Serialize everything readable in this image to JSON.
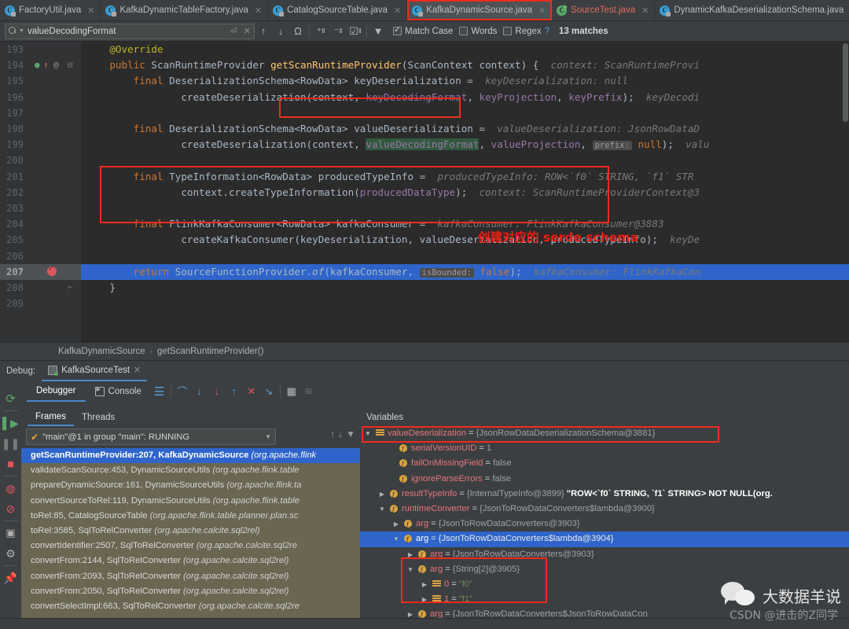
{
  "window": {
    "title": "IntelliJ IDEA - KafkaDynamicSource.java - Debugger"
  },
  "tabs": [
    {
      "label": "FactoryUtil.java",
      "icon": "java-class-icon",
      "active": false,
      "highlighted": false,
      "style": "normal"
    },
    {
      "label": "KafkaDynamicTableFactory.java",
      "icon": "java-class-icon",
      "active": false,
      "highlighted": false,
      "style": "normal"
    },
    {
      "label": "CatalogSourceTable.java",
      "icon": "java-class-icon",
      "active": false,
      "highlighted": false,
      "style": "normal"
    },
    {
      "label": "KafkaDynamicSource.java",
      "icon": "java-class-icon",
      "active": true,
      "highlighted": true,
      "style": "normal"
    },
    {
      "label": "SourceTest.java",
      "icon": "java-runnable-class-icon",
      "active": false,
      "highlighted": false,
      "style": "red"
    },
    {
      "label": "DynamicKafkaDeserializationSchema.java",
      "icon": "java-class-icon",
      "active": false,
      "highlighted": false,
      "style": "normal"
    }
  ],
  "find": {
    "query": "valueDecodingFormat",
    "placeholder": "Search",
    "match_case_label": "Match Case",
    "match_case_checked": true,
    "words_label": "Words",
    "words_checked": false,
    "regex_label": "Regex",
    "regex_checked": false,
    "help_label": "?",
    "matches_label": "13 matches",
    "buttons": [
      "prev-match",
      "next-match",
      "select-all-occurrences",
      "add-line-before",
      "add-line-after",
      "toggle-selection",
      "filter"
    ]
  },
  "editor": {
    "lines": [
      {
        "num": "193",
        "current": false,
        "text": "@Override"
      },
      {
        "num": "194",
        "current": false,
        "text": "public ScanRuntimeProvider getScanRuntimeProvider(ScanContext context) {   context: ScanRuntimeProvi"
      },
      {
        "num": "195",
        "current": false,
        "text": "final DeserializationSchema<RowData> keyDeserialization =   keyDeserialization: null"
      },
      {
        "num": "196",
        "current": false,
        "text": "createDeserialization(context, keyDecodingFormat, keyProjection, keyPrefix);   keyDecodi"
      },
      {
        "num": "197",
        "current": false,
        "text": ""
      },
      {
        "num": "198",
        "current": false,
        "text": "final DeserializationSchema<RowData> valueDeserialization =   valueDeserialization: JsonRowDataD"
      },
      {
        "num": "199",
        "current": false,
        "text": "createDeserialization(context, valueDecodingFormat, valueProjection, prefix: null);   valu"
      },
      {
        "num": "200",
        "current": false,
        "text": ""
      },
      {
        "num": "201",
        "current": false,
        "text": "final TypeInformation<RowData> producedTypeInfo =   producedTypeInfo: ROW<`f0` STRING, `f1` STR"
      },
      {
        "num": "202",
        "current": false,
        "text": "context.createTypeInformation(producedDataType);   context: ScanRuntimeProviderContext@3"
      },
      {
        "num": "203",
        "current": false,
        "text": ""
      },
      {
        "num": "204",
        "current": false,
        "text": "final FlinkKafkaConsumer<RowData> kafkaConsumer =   kafkaConsumer: FlinkKafkaConsumer@3883"
      },
      {
        "num": "205",
        "current": false,
        "text": "createKafkaConsumer(keyDeserialization, valueDeserialization, producedTypeInfo);   keyDe"
      },
      {
        "num": "206",
        "current": false,
        "text": ""
      },
      {
        "num": "207",
        "current": true,
        "text": "return SourceFunctionProvider.of(kafkaConsumer, isBounded: false);   kafkaConsumer: FlinkKafkaCon"
      },
      {
        "num": "208",
        "current": false,
        "text": "}"
      },
      {
        "num": "209",
        "current": false,
        "text": ""
      }
    ],
    "annotation_cn": "创建对应的 serde schema",
    "highlighted_token": "valueDecodingFormat",
    "method_name_boxed": "getScanRuntimeProvider",
    "breakpoint_line": "207"
  },
  "breadcrumb": {
    "class": "KafkaDynamicSource",
    "separator": "›",
    "method": "getScanRuntimeProvider()"
  },
  "debug": {
    "label": "Debug:",
    "session": "KafkaSourceTest",
    "tabs": [
      {
        "label": "Debugger",
        "selected": true
      },
      {
        "label": "Console",
        "selected": false
      }
    ],
    "toolbar_icons": [
      "show-execution-point",
      "step-over",
      "step-into",
      "force-step-into",
      "step-out",
      "drop-frame",
      "run-to-cursor",
      "evaluate-expression",
      "settings"
    ],
    "rail_icons": [
      "rerun-icon",
      "resume-icon",
      "pause-icon",
      "stop-icon",
      "view-breakpoints-icon",
      "mute-breakpoints-icon",
      "screenshot-icon",
      "settings-gear-icon",
      "pin-icon"
    ]
  },
  "frames": {
    "tabs": [
      {
        "label": "Frames",
        "selected": true
      },
      {
        "label": "Threads",
        "selected": false
      }
    ],
    "thread_selector": "\"main\"@1 in group \"main\": RUNNING",
    "rows": [
      {
        "main": "getScanRuntimeProvider:207, KafkaDynamicSource",
        "pkg": "(org.apache.flink",
        "selected": true
      },
      {
        "main": "validateScanSource:453, DynamicSourceUtils",
        "pkg": "(org.apache.flink.table",
        "selected": false
      },
      {
        "main": "prepareDynamicSource:161, DynamicSourceUtils",
        "pkg": "(org.apache.flink.ta",
        "selected": false
      },
      {
        "main": "convertSourceToRel:119, DynamicSourceUtils",
        "pkg": "(org.apache.flink.table",
        "selected": false
      },
      {
        "main": "toRel:85, CatalogSourceTable",
        "pkg": "(org.apache.flink.table.planner.plan.sc",
        "selected": false
      },
      {
        "main": "toRel:3585, SqlToRelConverter",
        "pkg": "(org.apache.calcite.sql2rel)",
        "selected": false
      },
      {
        "main": "convertIdentifier:2507, SqlToRelConverter",
        "pkg": "(org.apache.calcite.sql2re",
        "selected": false
      },
      {
        "main": "convertFrom:2144, SqlToRelConverter",
        "pkg": "(org.apache.calcite.sql2rel)",
        "selected": false
      },
      {
        "main": "convertFrom:2093, SqlToRelConverter",
        "pkg": "(org.apache.calcite.sql2rel)",
        "selected": false
      },
      {
        "main": "convertFrom:2050, SqlToRelConverter",
        "pkg": "(org.apache.calcite.sql2rel)",
        "selected": false
      },
      {
        "main": "convertSelectImpl:663, SqlToRelConverter",
        "pkg": "(org.apache.calcite.sql2re",
        "selected": false
      }
    ]
  },
  "variables": {
    "header": "Variables",
    "rows": [
      {
        "indent": 0,
        "arrow": "▼",
        "icon": "obj",
        "name": "valueDeserialization",
        "eq": "=",
        "value": "{JsonRowDataDeserializationSchema@3881}",
        "selected": false,
        "boxed": true
      },
      {
        "indent": 1,
        "arrow": "",
        "icon": "field",
        "name": "serialVersionUID",
        "eq": "=",
        "value": "1",
        "selected": false,
        "boxed": false
      },
      {
        "indent": 1,
        "arrow": "",
        "icon": "field",
        "name": "failOnMissingField",
        "eq": "=",
        "value": "false",
        "selected": false,
        "boxed": false
      },
      {
        "indent": 1,
        "arrow": "",
        "icon": "field",
        "name": "ignoreParseErrors",
        "eq": "=",
        "value": "false",
        "selected": false,
        "boxed": false
      },
      {
        "indent": 1,
        "arrow": "▶",
        "icon": "field",
        "name": "resultTypeInfo",
        "eq": "=",
        "value": "{InternalTypeInfo@3899}",
        "extra": "\"ROW<`f0` STRING, `f1` STRING> NOT NULL(org.",
        "selected": false,
        "boxed": false
      },
      {
        "indent": 1,
        "arrow": "▼",
        "icon": "field",
        "name": "runtimeConverter",
        "eq": "=",
        "value": "{JsonToRowDataConverters$lambda@3900}",
        "selected": false,
        "boxed": false
      },
      {
        "indent": 2,
        "arrow": "▶",
        "icon": "field",
        "name": "arg",
        "eq": "=",
        "value": "{JsonToRowDataConverters@3903}",
        "selected": false,
        "boxed": false
      },
      {
        "indent": 2,
        "arrow": "▼",
        "icon": "field",
        "name": "arg",
        "eq": "=",
        "value": "{JsonToRowDataConverters$lambda@3904}",
        "selected": true,
        "boxed": false
      },
      {
        "indent": 3,
        "arrow": "▶",
        "icon": "field",
        "name": "arg",
        "eq": "=",
        "value": "{JsonToRowDataConverters@3903}",
        "selected": false,
        "boxed": false
      },
      {
        "indent": 3,
        "arrow": "▼",
        "icon": "field",
        "name": "arg",
        "eq": "=",
        "value": "{String[2]@3905}",
        "selected": false,
        "boxed": false
      },
      {
        "indent": 4,
        "arrow": "▶",
        "icon": "obj",
        "name": "0",
        "eq": "=",
        "value": "\"f0\"",
        "isstr": true,
        "selected": false,
        "boxed": false
      },
      {
        "indent": 4,
        "arrow": "▶",
        "icon": "obj",
        "name": "1",
        "eq": "=",
        "value": "\"f1\"",
        "isstr": true,
        "selected": false,
        "boxed": false
      },
      {
        "indent": 3,
        "arrow": "▶",
        "icon": "field",
        "name": "arg",
        "eq": "=",
        "value": "{JsonToRowDataConverters$JsonToRowDataCon",
        "selected": false,
        "boxed": false
      }
    ]
  },
  "watermark": {
    "wechat_name": "大数据羊说",
    "csdn": "CSDN @进击的Z同学"
  },
  "colors": {
    "accent_blue": "#2f65ca",
    "annotation_red": "#f02b1d",
    "keyword_orange": "#cc7832",
    "method_yellow": "#ffc66d",
    "field_purple": "#9876aa",
    "string_green": "#6a8759",
    "editor_bg": "#2b2b2b",
    "panel_bg": "#3c3f41"
  }
}
